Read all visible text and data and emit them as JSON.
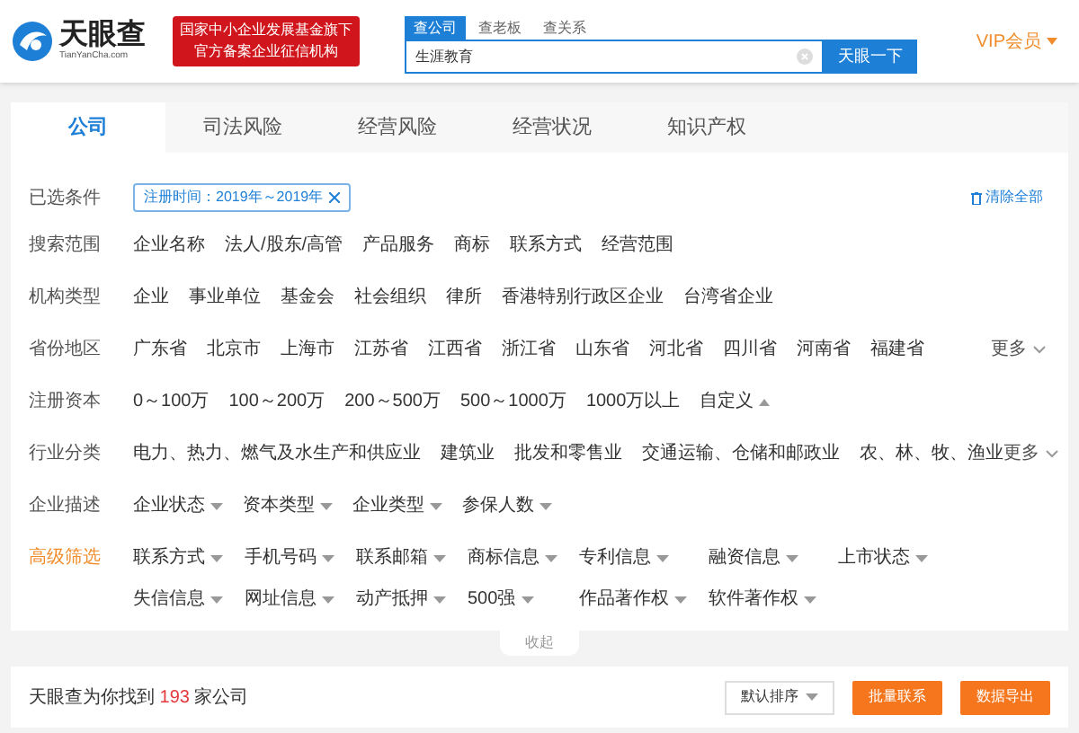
{
  "header": {
    "logo": {
      "name": "天眼查",
      "domain": "TianYanCha.com"
    },
    "badge": [
      "国家中小企业发展基金旗下",
      "官方备案企业征信机构"
    ],
    "search_tabs": [
      {
        "label": "查公司",
        "selected": true
      },
      {
        "label": "查老板",
        "selected": false
      },
      {
        "label": "查关系",
        "selected": false
      }
    ],
    "search": {
      "value": "生涯教育",
      "button": "天眼一下"
    },
    "vip": "VIP会员"
  },
  "tabs": [
    {
      "label": "公司",
      "selected": true
    },
    {
      "label": "司法风险",
      "selected": false
    },
    {
      "label": "经营风险",
      "selected": false
    },
    {
      "label": "经营状况",
      "selected": false
    },
    {
      "label": "知识产权",
      "selected": false
    }
  ],
  "selected_filters": {
    "label": "已选条件",
    "chips": [
      "注册时间：2019年～2019年"
    ],
    "clear": "清除全部"
  },
  "filter_rows": [
    {
      "label": "搜索范围",
      "items": [
        {
          "text": "企业名称",
          "kind": "plain"
        },
        {
          "text": "法人/股东/高管",
          "kind": "plain"
        },
        {
          "text": "产品服务",
          "kind": "plain"
        },
        {
          "text": "商标",
          "kind": "plain"
        },
        {
          "text": "联系方式",
          "kind": "plain"
        },
        {
          "text": "经营范围",
          "kind": "plain"
        }
      ]
    },
    {
      "label": "机构类型",
      "items": [
        {
          "text": "企业",
          "kind": "plain"
        },
        {
          "text": "事业单位",
          "kind": "plain"
        },
        {
          "text": "基金会",
          "kind": "plain"
        },
        {
          "text": "社会组织",
          "kind": "plain"
        },
        {
          "text": "律所",
          "kind": "plain"
        },
        {
          "text": "香港特别行政区企业",
          "kind": "plain"
        },
        {
          "text": "台湾省企业",
          "kind": "plain"
        }
      ]
    },
    {
      "label": "省份地区",
      "more": "更多",
      "items": [
        {
          "text": "广东省",
          "kind": "plain"
        },
        {
          "text": "北京市",
          "kind": "plain"
        },
        {
          "text": "上海市",
          "kind": "plain"
        },
        {
          "text": "江苏省",
          "kind": "plain"
        },
        {
          "text": "江西省",
          "kind": "plain"
        },
        {
          "text": "浙江省",
          "kind": "plain"
        },
        {
          "text": "山东省",
          "kind": "plain"
        },
        {
          "text": "河北省",
          "kind": "plain"
        },
        {
          "text": "四川省",
          "kind": "plain"
        },
        {
          "text": "河南省",
          "kind": "plain"
        },
        {
          "text": "福建省",
          "kind": "plain"
        }
      ]
    },
    {
      "label": "注册资本",
      "items": [
        {
          "text": "0～100万",
          "kind": "plain"
        },
        {
          "text": "100～200万",
          "kind": "plain"
        },
        {
          "text": "200～500万",
          "kind": "plain"
        },
        {
          "text": "500～1000万",
          "kind": "plain"
        },
        {
          "text": "1000万以上",
          "kind": "plain"
        },
        {
          "text": "自定义",
          "kind": "custom"
        }
      ]
    },
    {
      "label": "行业分类",
      "more": "更多",
      "items": [
        {
          "text": "电力、热力、燃气及水生产和供应业",
          "kind": "plain"
        },
        {
          "text": "建筑业",
          "kind": "plain"
        },
        {
          "text": "批发和零售业",
          "kind": "plain"
        },
        {
          "text": "交通运输、仓储和邮政业",
          "kind": "plain"
        },
        {
          "text": "农、林、牧、渔业",
          "kind": "plain"
        }
      ]
    },
    {
      "label": "企业描述",
      "items": [
        {
          "text": "企业状态",
          "kind": "dropdown"
        },
        {
          "text": "资本类型",
          "kind": "dropdown"
        },
        {
          "text": "企业类型",
          "kind": "dropdown"
        },
        {
          "text": "参保人数",
          "kind": "dropdown"
        }
      ]
    },
    {
      "label": "高级筛选",
      "highlight": true,
      "items": [
        {
          "text": "联系方式",
          "kind": "dropdown"
        },
        {
          "text": "手机号码",
          "kind": "dropdown"
        },
        {
          "text": "联系邮箱",
          "kind": "dropdown"
        },
        {
          "text": "商标信息",
          "kind": "dropdown"
        },
        {
          "text": "专利信息",
          "kind": "dropdown"
        },
        {
          "text": "融资信息",
          "kind": "dropdown"
        },
        {
          "text": "上市状态",
          "kind": "dropdown"
        },
        {
          "text": "失信信息",
          "kind": "dropdown"
        },
        {
          "text": "网址信息",
          "kind": "dropdown"
        },
        {
          "text": "动产抵押",
          "kind": "dropdown"
        },
        {
          "text": "500强",
          "kind": "dropdown"
        },
        {
          "text": "作品著作权",
          "kind": "dropdown"
        },
        {
          "text": "软件著作权",
          "kind": "dropdown"
        }
      ]
    }
  ],
  "collapse": "收起",
  "results": {
    "prefix": "天眼查为你找到",
    "count": "193",
    "suffix": "家公司",
    "sort": "默认排序",
    "buttons": [
      "批量联系",
      "数据导出"
    ]
  }
}
